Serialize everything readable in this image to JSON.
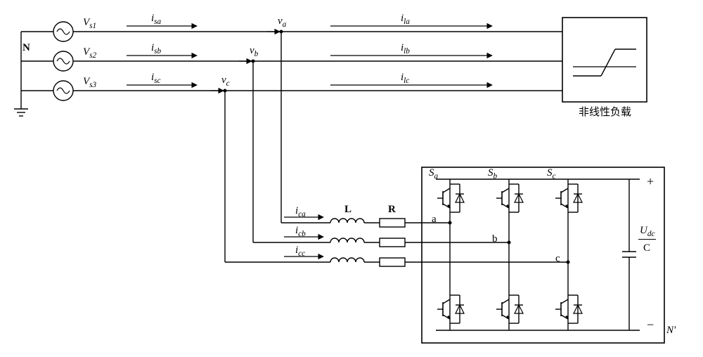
{
  "neutral_label": "N",
  "sources": {
    "vs1": "V",
    "vs1_sub": "s1",
    "vs2": "V",
    "vs2_sub": "s2",
    "vs3": "V",
    "vs3_sub": "s3"
  },
  "source_currents": {
    "isa": "i",
    "isa_sub": "sa",
    "isb": "i",
    "isb_sub": "sb",
    "isc": "i",
    "isc_sub": "sc"
  },
  "bus_voltages": {
    "va": "v",
    "va_sub": "a",
    "vb": "v",
    "vb_sub": "b",
    "vc": "v",
    "vc_sub": "c"
  },
  "load_currents": {
    "ila": "i",
    "ila_sub": "la",
    "ilb": "i",
    "ilb_sub": "lb",
    "ilc": "i",
    "ilc_sub": "lc"
  },
  "load_label": "非线性负载",
  "comp_currents": {
    "ica": "i",
    "ica_sub": "ca",
    "icb": "i",
    "icb_sub": "cb",
    "icc": "i",
    "icc_sub": "cc"
  },
  "inductor_label": "L",
  "resistor_label": "R",
  "phase_nodes": {
    "a": "a",
    "b": "b",
    "c": "c"
  },
  "switches": {
    "sa": "S",
    "sa_sub": "a",
    "sb": "S",
    "sb_sub": "b",
    "sc": "S",
    "sc_sub": "c"
  },
  "dc_bus": {
    "plus": "+",
    "minus": "−",
    "udc": "U",
    "udc_sub": "dc",
    "cap": "C",
    "nprime": "N′"
  }
}
